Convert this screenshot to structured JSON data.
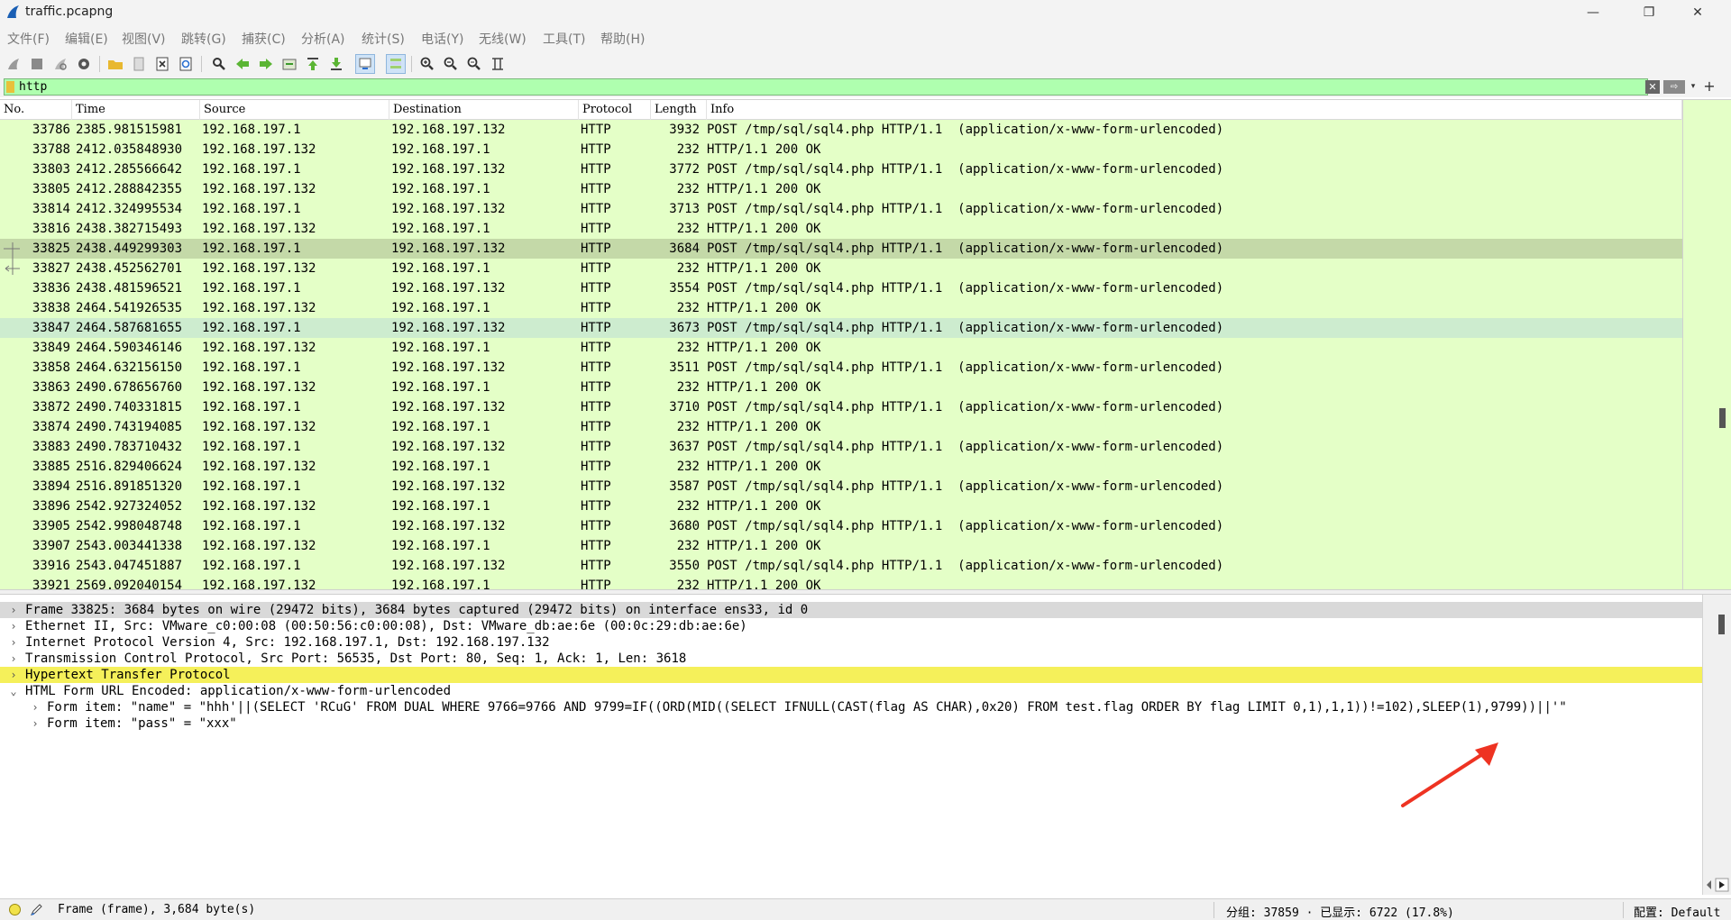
{
  "window": {
    "title": "traffic.pcapng",
    "icon": "wireshark-fin-icon",
    "controls": {
      "minimize": "—",
      "maximize": "❐",
      "close": "✕"
    }
  },
  "menu": [
    "文件(F)",
    "编辑(E)",
    "视图(V)",
    "跳转(G)",
    "捕获(C)",
    "分析(A)",
    "统计(S)",
    "电话(Y)",
    "无线(W)",
    "工具(T)",
    "帮助(H)"
  ],
  "filter": {
    "value": "http",
    "clear_icon": "✕",
    "apply_icon": "⇨",
    "dropdown_icon": "▾",
    "add_icon": "+",
    "colors": {
      "valid_bg": "#afffaf"
    }
  },
  "packet_list": {
    "columns": [
      "No.",
      "Time",
      "Source",
      "Destination",
      "Protocol",
      "Length",
      "Info"
    ],
    "selected_no": "33825",
    "colors": {
      "row_bg": "#e4ffc7",
      "selected_bg": "#c4d9a8",
      "hover_bg": "#cdeccf"
    },
    "rows": [
      {
        "no": "33786",
        "time": "2385.981515981",
        "src": "192.168.197.1",
        "dst": "192.168.197.132",
        "proto": "HTTP",
        "len": "3932",
        "info": "POST /tmp/sql/sql4.php HTTP/1.1  (application/x-www-form-urlencoded)"
      },
      {
        "no": "33788",
        "time": "2412.035848930",
        "src": "192.168.197.132",
        "dst": "192.168.197.1",
        "proto": "HTTP",
        "len": "232",
        "info": "HTTP/1.1 200 OK"
      },
      {
        "no": "33803",
        "time": "2412.285566642",
        "src": "192.168.197.1",
        "dst": "192.168.197.132",
        "proto": "HTTP",
        "len": "3772",
        "info": "POST /tmp/sql/sql4.php HTTP/1.1  (application/x-www-form-urlencoded)"
      },
      {
        "no": "33805",
        "time": "2412.288842355",
        "src": "192.168.197.132",
        "dst": "192.168.197.1",
        "proto": "HTTP",
        "len": "232",
        "info": "HTTP/1.1 200 OK"
      },
      {
        "no": "33814",
        "time": "2412.324995534",
        "src": "192.168.197.1",
        "dst": "192.168.197.132",
        "proto": "HTTP",
        "len": "3713",
        "info": "POST /tmp/sql/sql4.php HTTP/1.1  (application/x-www-form-urlencoded)"
      },
      {
        "no": "33816",
        "time": "2438.382715493",
        "src": "192.168.197.132",
        "dst": "192.168.197.1",
        "proto": "HTTP",
        "len": "232",
        "info": "HTTP/1.1 200 OK"
      },
      {
        "no": "33825",
        "time": "2438.449299303",
        "src": "192.168.197.1",
        "dst": "192.168.197.132",
        "proto": "HTTP",
        "len": "3684",
        "info": "POST /tmp/sql/sql4.php HTTP/1.1  (application/x-www-form-urlencoded)"
      },
      {
        "no": "33827",
        "time": "2438.452562701",
        "src": "192.168.197.132",
        "dst": "192.168.197.1",
        "proto": "HTTP",
        "len": "232",
        "info": "HTTP/1.1 200 OK"
      },
      {
        "no": "33836",
        "time": "2438.481596521",
        "src": "192.168.197.1",
        "dst": "192.168.197.132",
        "proto": "HTTP",
        "len": "3554",
        "info": "POST /tmp/sql/sql4.php HTTP/1.1  (application/x-www-form-urlencoded)"
      },
      {
        "no": "33838",
        "time": "2464.541926535",
        "src": "192.168.197.132",
        "dst": "192.168.197.1",
        "proto": "HTTP",
        "len": "232",
        "info": "HTTP/1.1 200 OK"
      },
      {
        "no": "33847",
        "time": "2464.587681655",
        "src": "192.168.197.1",
        "dst": "192.168.197.132",
        "proto": "HTTP",
        "len": "3673",
        "info": "POST /tmp/sql/sql4.php HTTP/1.1  (application/x-www-form-urlencoded)"
      },
      {
        "no": "33849",
        "time": "2464.590346146",
        "src": "192.168.197.132",
        "dst": "192.168.197.1",
        "proto": "HTTP",
        "len": "232",
        "info": "HTTP/1.1 200 OK"
      },
      {
        "no": "33858",
        "time": "2464.632156150",
        "src": "192.168.197.1",
        "dst": "192.168.197.132",
        "proto": "HTTP",
        "len": "3511",
        "info": "POST /tmp/sql/sql4.php HTTP/1.1  (application/x-www-form-urlencoded)"
      },
      {
        "no": "33863",
        "time": "2490.678656760",
        "src": "192.168.197.132",
        "dst": "192.168.197.1",
        "proto": "HTTP",
        "len": "232",
        "info": "HTTP/1.1 200 OK"
      },
      {
        "no": "33872",
        "time": "2490.740331815",
        "src": "192.168.197.1",
        "dst": "192.168.197.132",
        "proto": "HTTP",
        "len": "3710",
        "info": "POST /tmp/sql/sql4.php HTTP/1.1  (application/x-www-form-urlencoded)"
      },
      {
        "no": "33874",
        "time": "2490.743194085",
        "src": "192.168.197.132",
        "dst": "192.168.197.1",
        "proto": "HTTP",
        "len": "232",
        "info": "HTTP/1.1 200 OK"
      },
      {
        "no": "33883",
        "time": "2490.783710432",
        "src": "192.168.197.1",
        "dst": "192.168.197.132",
        "proto": "HTTP",
        "len": "3637",
        "info": "POST /tmp/sql/sql4.php HTTP/1.1  (application/x-www-form-urlencoded)"
      },
      {
        "no": "33885",
        "time": "2516.829406624",
        "src": "192.168.197.132",
        "dst": "192.168.197.1",
        "proto": "HTTP",
        "len": "232",
        "info": "HTTP/1.1 200 OK"
      },
      {
        "no": "33894",
        "time": "2516.891851320",
        "src": "192.168.197.1",
        "dst": "192.168.197.132",
        "proto": "HTTP",
        "len": "3587",
        "info": "POST /tmp/sql/sql4.php HTTP/1.1  (application/x-www-form-urlencoded)"
      },
      {
        "no": "33896",
        "time": "2542.927324052",
        "src": "192.168.197.132",
        "dst": "192.168.197.1",
        "proto": "HTTP",
        "len": "232",
        "info": "HTTP/1.1 200 OK"
      },
      {
        "no": "33905",
        "time": "2542.998048748",
        "src": "192.168.197.1",
        "dst": "192.168.197.132",
        "proto": "HTTP",
        "len": "3680",
        "info": "POST /tmp/sql/sql4.php HTTP/1.1  (application/x-www-form-urlencoded)"
      },
      {
        "no": "33907",
        "time": "2543.003441338",
        "src": "192.168.197.132",
        "dst": "192.168.197.1",
        "proto": "HTTP",
        "len": "232",
        "info": "HTTP/1.1 200 OK"
      },
      {
        "no": "33916",
        "time": "2543.047451887",
        "src": "192.168.197.1",
        "dst": "192.168.197.132",
        "proto": "HTTP",
        "len": "3550",
        "info": "POST /tmp/sql/sql4.php HTTP/1.1  (application/x-www-form-urlencoded)"
      },
      {
        "no": "33921",
        "time": "2569.092040154",
        "src": "192.168.197.132",
        "dst": "192.168.197.1",
        "proto": "HTTP",
        "len": "232",
        "info": "HTTP/1.1 200 OK"
      }
    ]
  },
  "details": {
    "colors": {
      "frame_bg": "#d9d9d9",
      "http_bg": "#f5f05a"
    },
    "tree": [
      {
        "twisty": "›",
        "text": "Frame 33825: 3684 bytes on wire (29472 bits), 3684 bytes captured (29472 bits) on interface ens33, id 0",
        "kind": "frame"
      },
      {
        "twisty": "›",
        "text": "Ethernet II, Src: VMware_c0:00:08 (00:50:56:c0:00:08), Dst: VMware_db:ae:6e (00:0c:29:db:ae:6e)",
        "kind": "normal"
      },
      {
        "twisty": "›",
        "text": "Internet Protocol Version 4, Src: 192.168.197.1, Dst: 192.168.197.132",
        "kind": "normal"
      },
      {
        "twisty": "›",
        "text": "Transmission Control Protocol, Src Port: 56535, Dst Port: 80, Seq: 1, Ack: 1, Len: 3618",
        "kind": "normal"
      },
      {
        "twisty": "›",
        "text": "Hypertext Transfer Protocol",
        "kind": "http"
      },
      {
        "twisty": "⌄",
        "text": "HTML Form URL Encoded: application/x-www-form-urlencoded",
        "kind": "normal"
      },
      {
        "twisty": "›",
        "text": "Form item: \"name\" = \"hhh'||(SELECT 'RCuG' FROM DUAL WHERE 9766=9766 AND 9799=IF((ORD(MID((SELECT IFNULL(CAST(flag AS CHAR),0x20) FROM test.flag ORDER BY flag LIMIT 0,1),1,1))!=102),SLEEP(1),9799))||'\"",
        "kind": "child"
      },
      {
        "twisty": "›",
        "text": "Form item: \"pass\" = \"xxx\"",
        "kind": "child"
      }
    ]
  },
  "annotation": {
    "arrow_color": "#ee3322"
  },
  "status": {
    "frame": "Frame (frame), 3,684 byte(s)",
    "packets": "分组: 37859 · 已显示: 6722 (17.8%)",
    "profile": "配置: Default"
  }
}
